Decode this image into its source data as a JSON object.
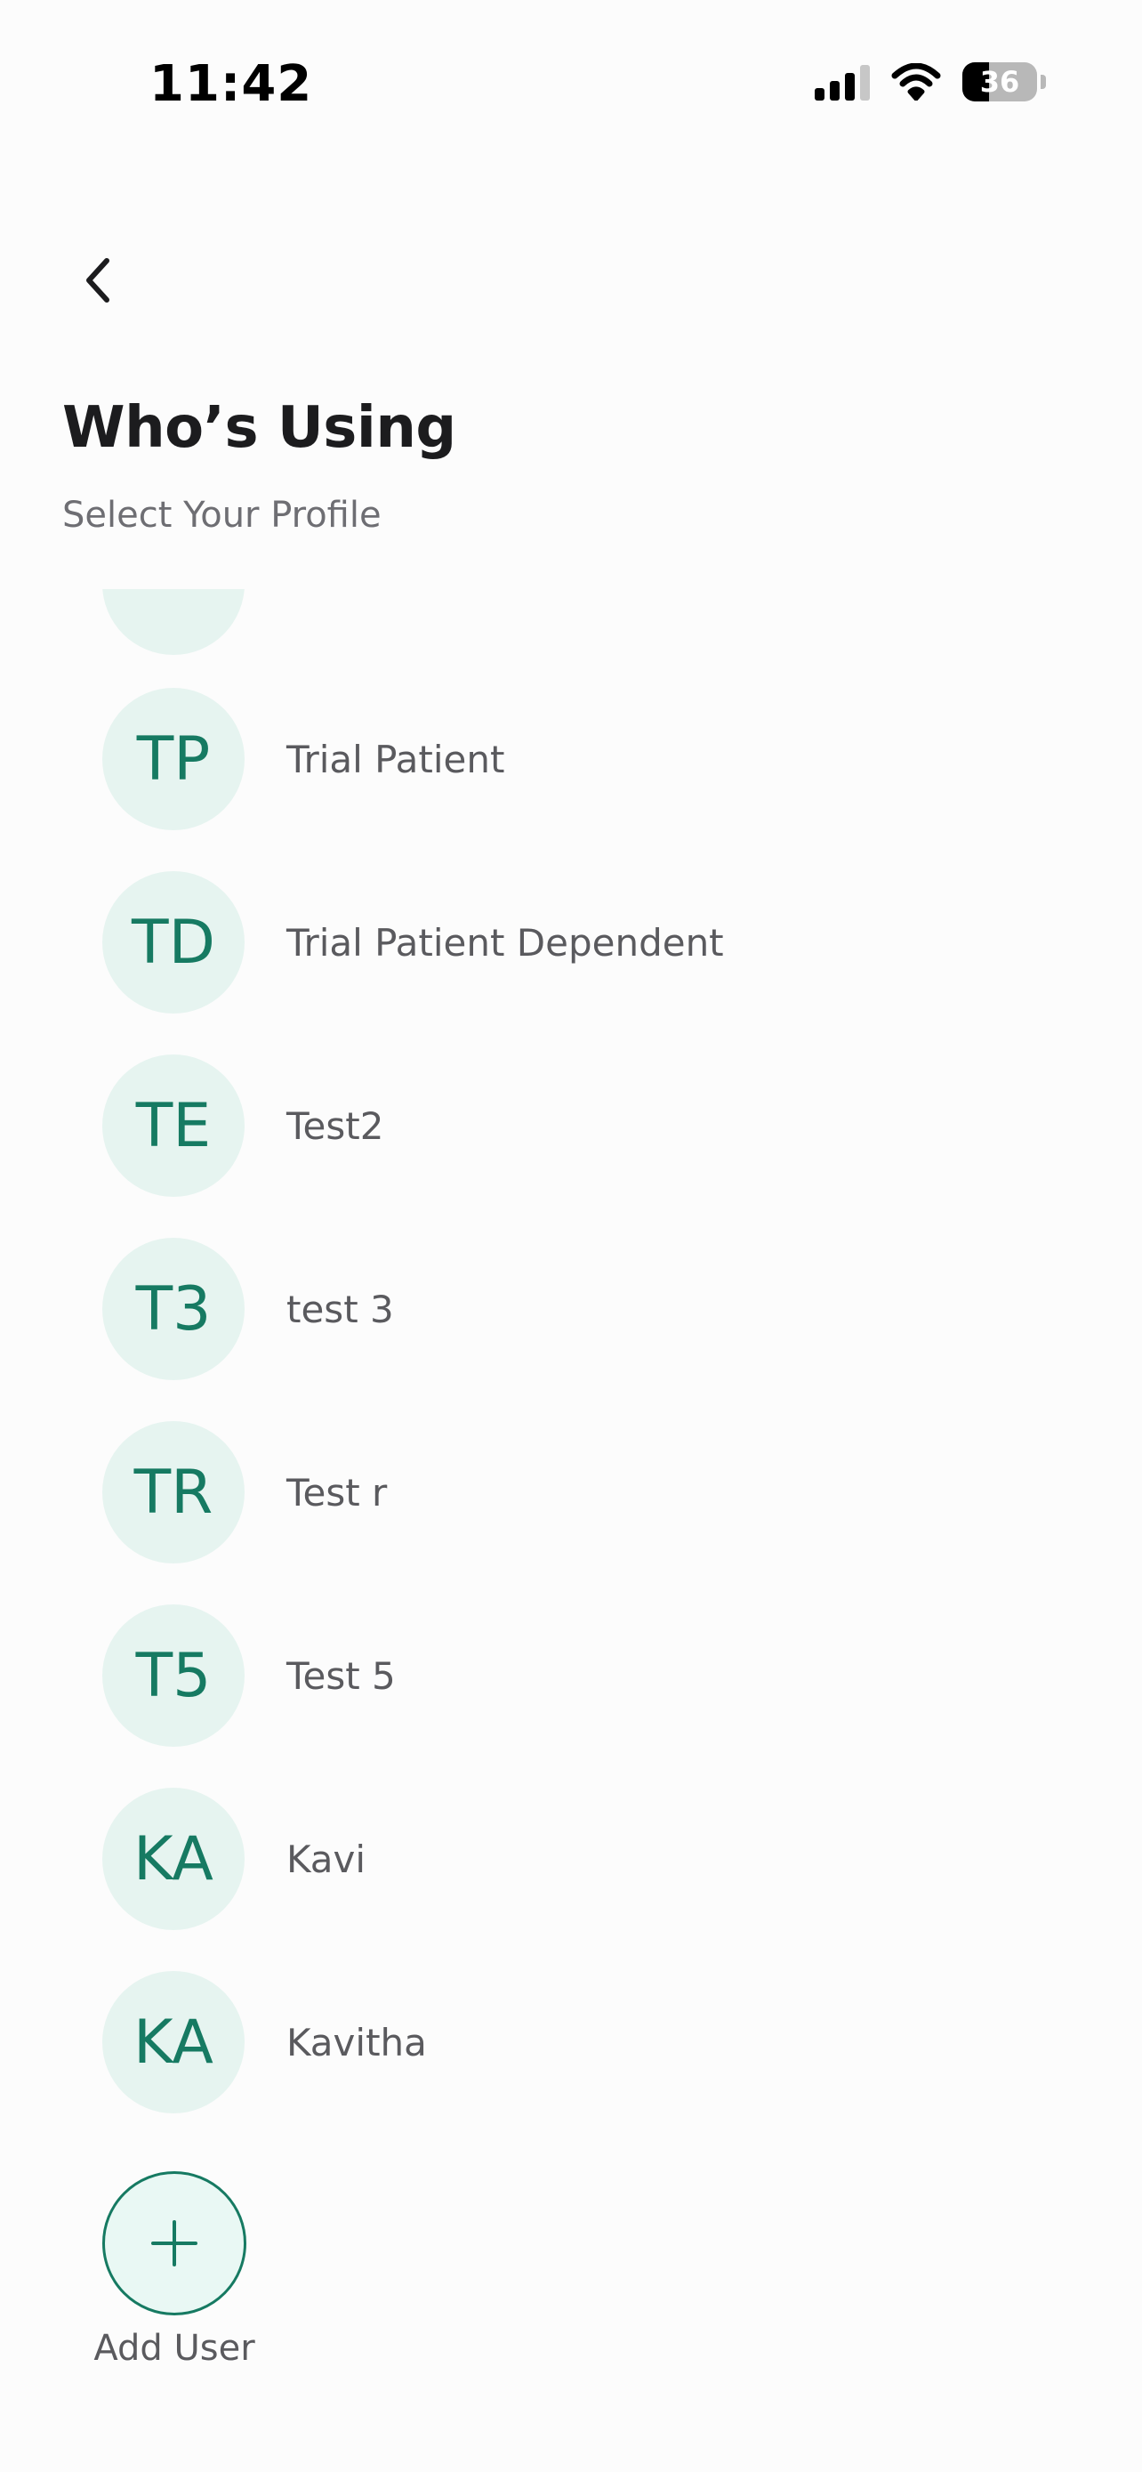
{
  "status_bar": {
    "time": "11:42",
    "battery_level": "36",
    "battery_fraction": 0.36,
    "icons": [
      "cellular-signal-icon",
      "wifi-icon",
      "battery-icon"
    ]
  },
  "header": {
    "back_icon": "chevron-left-icon",
    "title": "Who’s Using",
    "subtitle": "Select Your Profile"
  },
  "profiles": [
    {
      "initials": "TP",
      "name": "Trial Patient"
    },
    {
      "initials": "TD",
      "name": "Trial Patient Dependent"
    },
    {
      "initials": "TE",
      "name": "Test2"
    },
    {
      "initials": "T3",
      "name": "test 3"
    },
    {
      "initials": "TR",
      "name": "Test r"
    },
    {
      "initials": "T5",
      "name": "Test 5"
    },
    {
      "initials": "KA",
      "name": "Kavi"
    },
    {
      "initials": "KA",
      "name": "Kavitha"
    }
  ],
  "add_user": {
    "icon": "plus-icon",
    "label": "Add User"
  },
  "colors": {
    "accent": "#167a62",
    "avatar_bg": "#e6f4f0",
    "background": "#fcfcfc",
    "secondary_text": "#5a5a5e"
  }
}
